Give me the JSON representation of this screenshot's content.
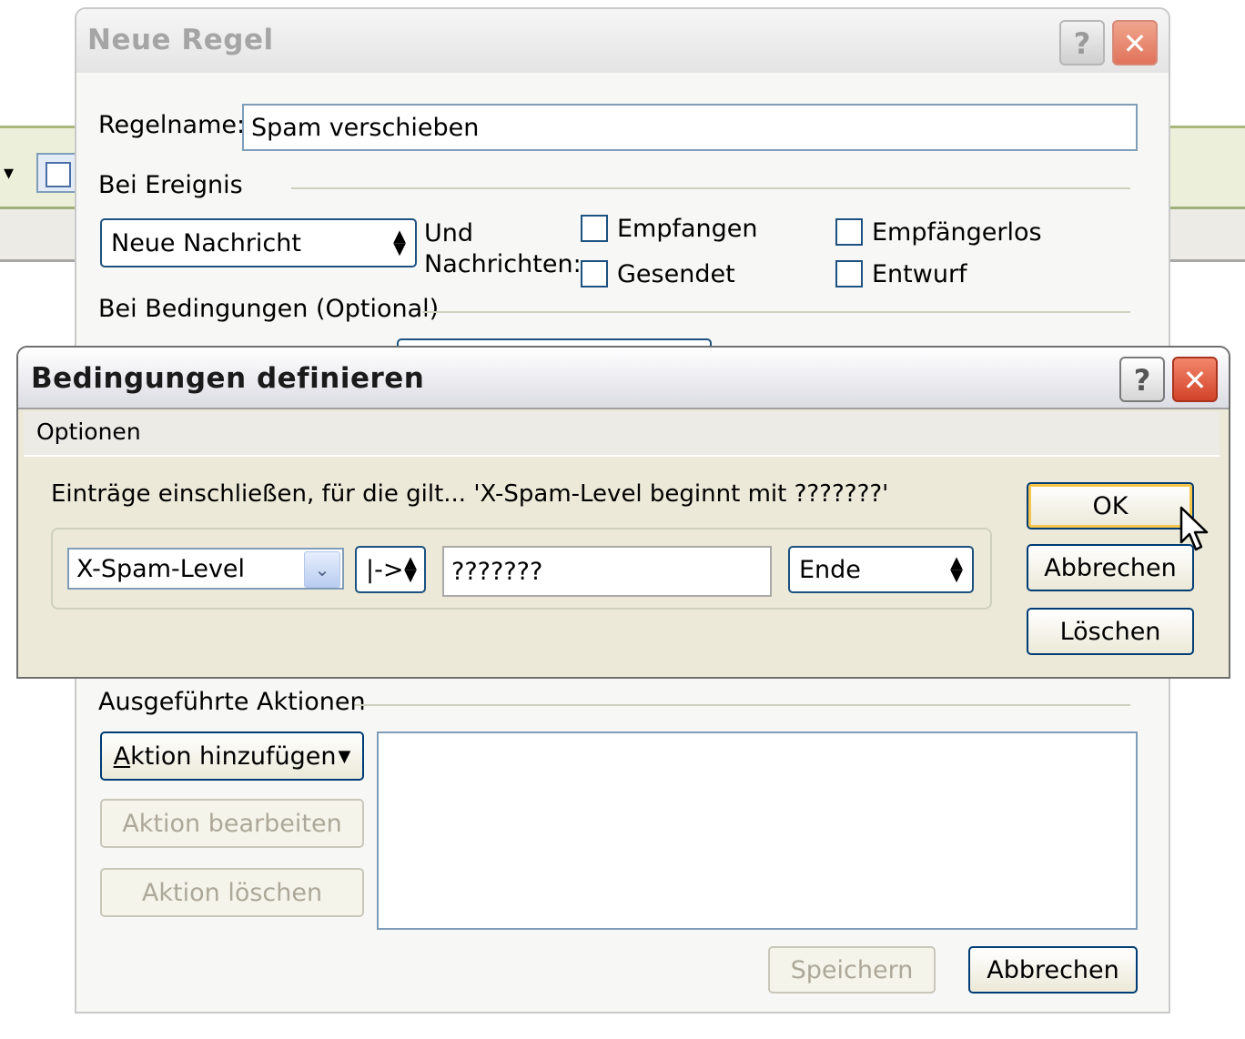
{
  "main_window": {
    "title": "Neue Regel",
    "rule_name_label": "Regelname:",
    "rule_name_value": "Spam verschieben",
    "event_section": "Bei Ereignis",
    "event_select": "Neue Nachricht",
    "and_messages_label": "Und\nNachrichten:",
    "and_line1": "Und",
    "and_line2": "Nachrichten:",
    "cb_received": "Empfangen",
    "cb_sent": "Gesendet",
    "cb_no_recipient": "Empfängerlos",
    "cb_draft": "Entwurf",
    "conditions_section": "Bei Bedingungen",
    "conditions_optional": "(Optional)",
    "actions_section": "Ausgeführte Aktionen",
    "add_action_prefix": "A",
    "add_action_rest": "ktion hinzufügen",
    "edit_action": "Aktion bearbeiten",
    "delete_action": "Aktion löschen",
    "save": "Speichern",
    "cancel": "Abbrechen"
  },
  "dialog": {
    "title": "Bedingungen definieren",
    "menu_options": "Optionen",
    "description": "Einträge einschließen, für die gilt... 'X-Spam-Level  beginnt mit ???????'",
    "field_select": "X-Spam-Level",
    "operator_select": "|->",
    "value_input": "???????",
    "end_select": "Ende",
    "ok": "OK",
    "cancel": "Abbrechen",
    "delete": "Löschen"
  },
  "title_buttons": {
    "help": "?",
    "close": "✕"
  }
}
